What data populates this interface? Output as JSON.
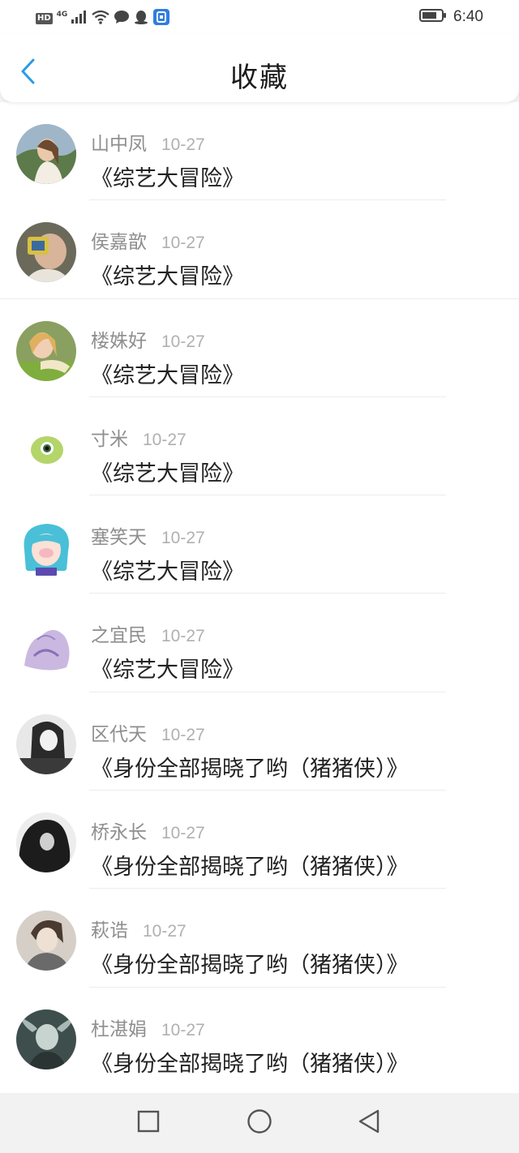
{
  "status_bar": {
    "hd": "HD",
    "network": "4G",
    "time": "6:40",
    "icons": [
      "signal-icon",
      "wifi-icon",
      "message-icon",
      "qq-icon",
      "app-notification-icon",
      "battery-icon"
    ]
  },
  "header": {
    "title": "收藏",
    "back_icon": "chevron-left-icon",
    "accent_color": "#2b9be6"
  },
  "favorites": [
    {
      "name": "山中凤",
      "date": "10-27",
      "title": "《综艺大冒险》"
    },
    {
      "name": "侯嘉歆",
      "date": "10-27",
      "title": "《综艺大冒险》"
    },
    {
      "name": "楼姝好",
      "date": "10-27",
      "title": "《综艺大冒险》"
    },
    {
      "name": "寸米",
      "date": "10-27",
      "title": "《综艺大冒险》"
    },
    {
      "name": "塞笑天",
      "date": "10-27",
      "title": "《综艺大冒险》"
    },
    {
      "name": "之宜民",
      "date": "10-27",
      "title": "《综艺大冒险》"
    },
    {
      "name": "区代天",
      "date": "10-27",
      "title": "《身份全部揭晓了哟（猪猪侠）》"
    },
    {
      "name": "桥永长",
      "date": "10-27",
      "title": "《身份全部揭晓了哟（猪猪侠）》"
    },
    {
      "name": "萩诰",
      "date": "10-27",
      "title": "《身份全部揭晓了哟（猪猪侠）》"
    },
    {
      "name": "杜湛娟",
      "date": "10-27",
      "title": "《身份全部揭晓了哟（猪猪侠）》"
    }
  ],
  "nav_bar": {
    "icons": [
      "recent-apps-icon",
      "home-icon",
      "back-triangle-icon"
    ]
  }
}
